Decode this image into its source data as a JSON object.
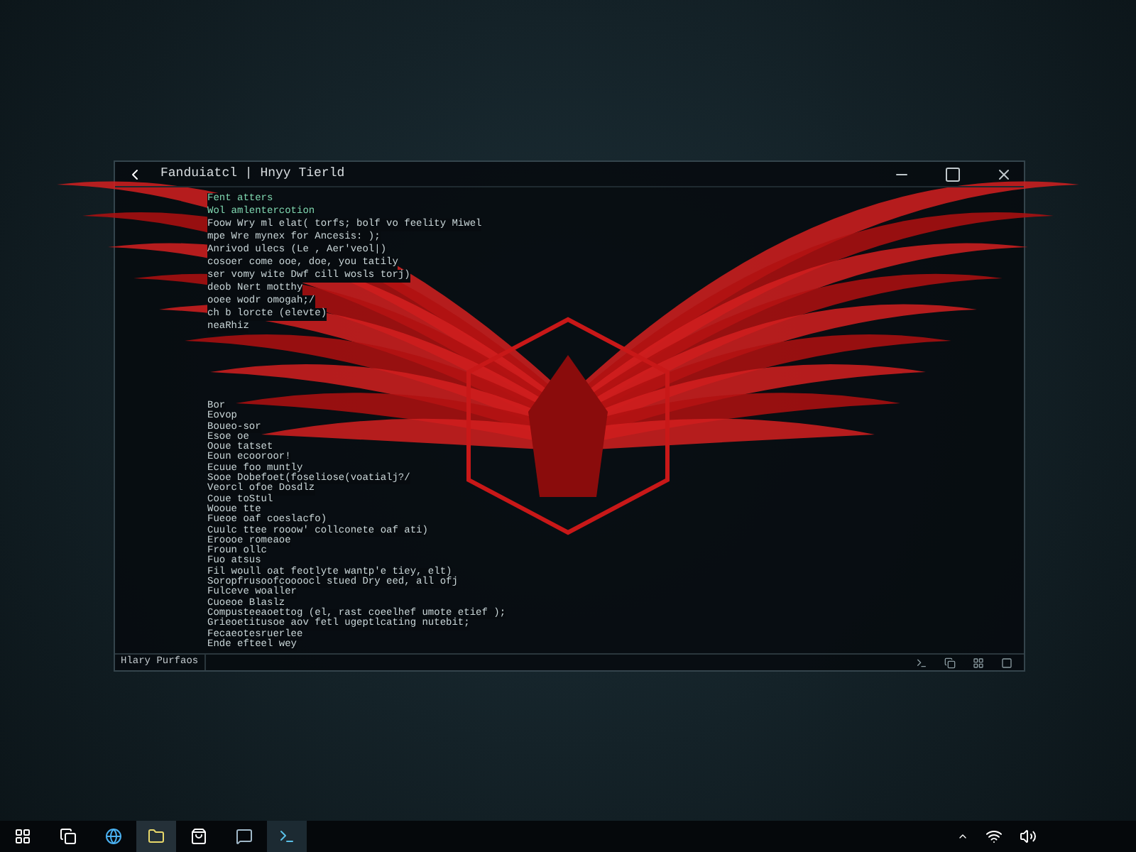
{
  "window": {
    "title": "Fanduiatcl | Hnyy Tierld"
  },
  "editor": {
    "blocks": [
      {
        "lines": [
          {
            "text": "Fent atters",
            "kind": "comment"
          },
          {
            "text": "Wol amlentercotion",
            "kind": "comment"
          },
          {
            "text": "Foow Wry ml elat( torfs; bolf vo feelity Miwel",
            "kind": "code"
          },
          {
            "text": "mpe Wre mynex for Ancesis: );",
            "kind": "code"
          },
          {
            "text": "Anrivod ulecs (Le , Aer'veol|)",
            "kind": "code"
          },
          {
            "text": "cosoer come ooe, doe, you tatily",
            "kind": "code"
          },
          {
            "text": "ser vomy wite Dwf cill wosls torj)",
            "kind": "code"
          },
          {
            "text": "deob Nert motthy",
            "kind": "code"
          },
          {
            "text": "ooee wodr omogah;/",
            "kind": "code"
          },
          {
            "text": "ch b lorcte (elevte)",
            "kind": "code"
          },
          {
            "text": "neaRhiz",
            "kind": "code"
          }
        ]
      },
      {
        "lines": [
          {
            "text": "Bor",
            "kind": "code"
          },
          {
            "text": "Eovop",
            "kind": "code"
          },
          {
            "text": "Boueo-sor",
            "kind": "code"
          },
          {
            "text": "Esoe oe",
            "kind": "code"
          },
          {
            "text": "Ooue tatset",
            "kind": "code"
          },
          {
            "text": "Eoun ecooroor!",
            "kind": "code"
          },
          {
            "text": "Ecuue foo muntly",
            "kind": "code"
          },
          {
            "text": "Sooe Dobefoet(foseliose(voatialj?/",
            "kind": "code"
          },
          {
            "text": "Veorcl ofoe Dosdlz",
            "kind": "code"
          },
          {
            "text": "Coue toStul",
            "kind": "code"
          },
          {
            "text": "Wooue tte",
            "kind": "code"
          },
          {
            "text": "Fueoe oaf coeslacfo)",
            "kind": "code"
          },
          {
            "text": "Cuulc ttee rooow' collconete oaf ati)",
            "kind": "code"
          },
          {
            "text": "Eroooe romeaoe",
            "kind": "code"
          },
          {
            "text": "Froun ollc",
            "kind": "code"
          },
          {
            "text": "Fuo atsus",
            "kind": "code"
          },
          {
            "text": "Fil woull oat feotlyte wantp'e tiey, elt)",
            "kind": "code"
          },
          {
            "text": "Soropfrusoofcoooocl stued Dry eed, all ofj",
            "kind": "code"
          },
          {
            "text": "Fulceve woaller",
            "kind": "code"
          },
          {
            "text": "Cuoeoe Blaslz",
            "kind": "code"
          },
          {
            "text": "Compusteeaoettog (el, rast coeelhef umote etief );",
            "kind": "code"
          },
          {
            "text": "Grieoetitusoe aov fetl ugeptlcating nutebit;",
            "kind": "code"
          },
          {
            "text": "Fecaeotesruerlee",
            "kind": "code"
          },
          {
            "text": "Ende efteel wey",
            "kind": "code"
          }
        ]
      }
    ]
  },
  "status_bar": {
    "label": "Hlary Purfaos"
  }
}
